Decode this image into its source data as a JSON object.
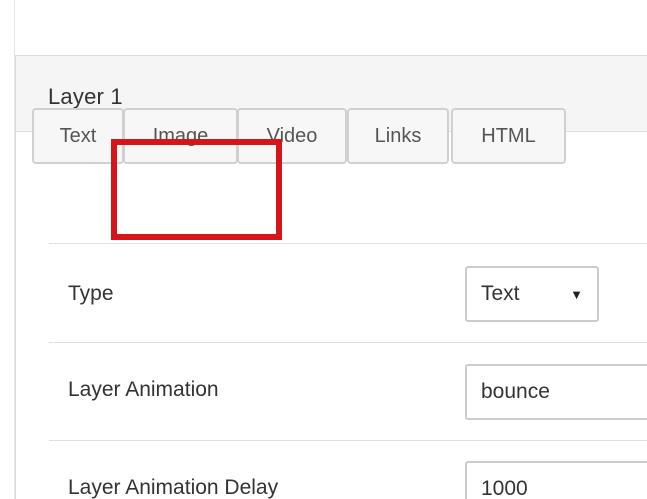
{
  "panel": {
    "title": "Layer 1"
  },
  "tabs": [
    {
      "label": "Text"
    },
    {
      "label": "Image"
    },
    {
      "label": "Video"
    },
    {
      "label": "Links"
    },
    {
      "label": "HTML"
    }
  ],
  "form": {
    "type": {
      "label": "Type",
      "value": "Text"
    },
    "animation": {
      "label": "Layer Animation",
      "value": "bounce"
    },
    "delay": {
      "label": "Layer Animation Delay",
      "value": "1000"
    }
  },
  "icons": {
    "caret": "▼"
  },
  "colors": {
    "highlight": "#d6151b",
    "heading_bg": "#f5f5f5",
    "border": "#dddddd"
  }
}
